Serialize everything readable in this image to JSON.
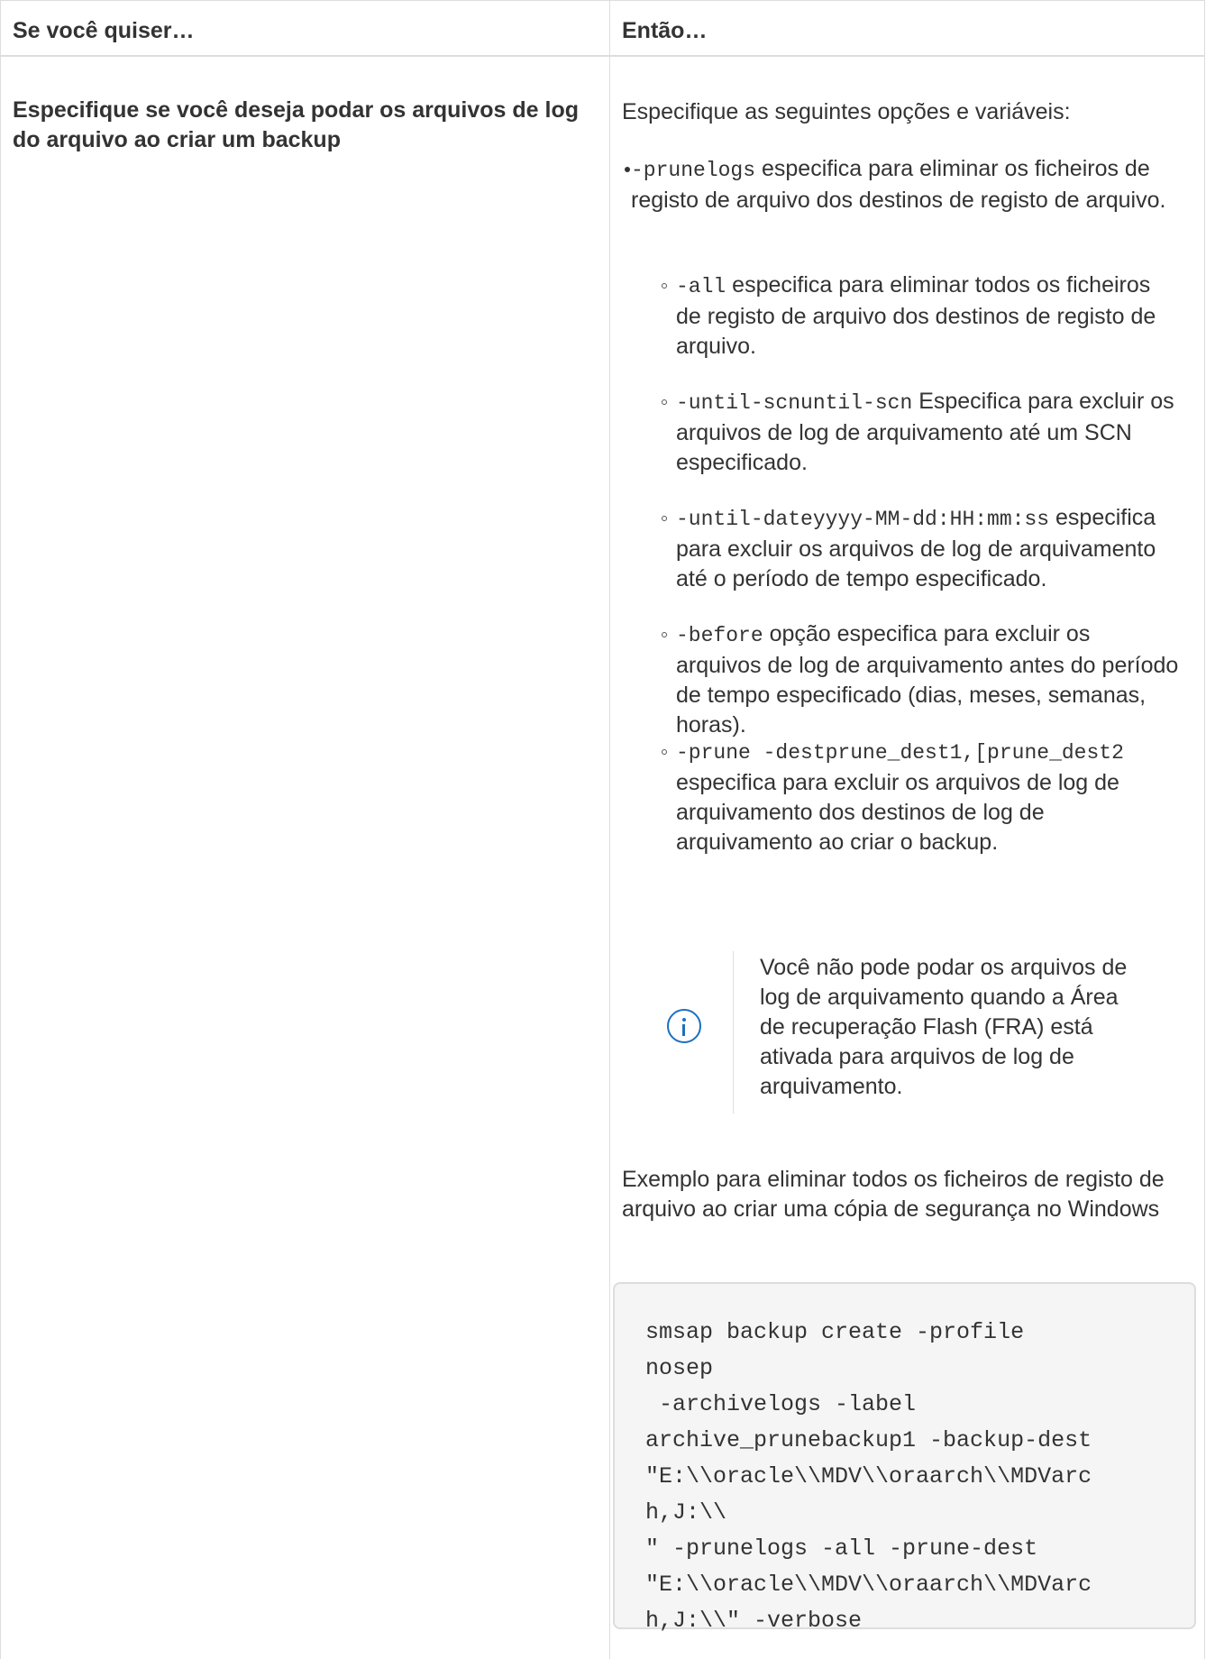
{
  "table": {
    "headers": [
      "Se você quiser…",
      "Então…"
    ],
    "row": {
      "left": "Especifique se você deseja podar os arquivos de log do arquivo ao criar um backup",
      "intro": "Especifique as seguintes opções e variáveis:",
      "bullet": {
        "code": "-prunelogs",
        "text": " especifica para eliminar os ficheiros de registo de arquivo dos destinos de registo de arquivo."
      },
      "subitems": [
        {
          "code": "-all",
          "text": " especifica para eliminar todos os ficheiros de registo de arquivo dos destinos de registo de arquivo."
        },
        {
          "code": "-until-scnuntil-scn",
          "text": " Especifica para excluir os arquivos de log de arquivamento até um SCN especificado."
        },
        {
          "code": "-until-dateyyyy-MM-dd:HH:mm:ss",
          "text": " especifica para excluir os arquivos de log de arquivamento até o período de tempo especificado."
        },
        {
          "code": "-before",
          "text": " opção especifica para excluir os arquivos de log de arquivamento antes do período de tempo especificado (dias, meses, semanas, horas)."
        },
        {
          "code": "-prune -destprune_dest1,[prune_dest2",
          "text": " especifica para excluir os arquivos de log de arquivamento dos destinos de log de arquivamento ao criar o backup."
        }
      ],
      "note": {
        "icon": "info-icon",
        "text": "Você não pode podar os arquivos de log de arquivamento quando a Área de recuperação Flash (FRA) está ativada para arquivos de log de arquivamento."
      },
      "example": "Exemplo para eliminar todos os ficheiros de registo de arquivo ao criar uma cópia de segurança no Windows",
      "code": "smsap backup create -profile\nnosep\n -archivelogs -label\narchive_prunebackup1 -backup-dest\n\"E:\\\\oracle\\\\MDV\\\\oraarch\\\\MDVarc\nh,J:\\\\\n\" -prunelogs -all -prune-dest\n\"E:\\\\oracle\\\\MDV\\\\oraarch\\\\MDVarc\nh,J:\\\\\" -verbose"
    }
  },
  "colors": {
    "border": "#dddddd",
    "text": "#333333",
    "info_icon": "#1e6fbf",
    "code_bg": "#f5f5f5"
  }
}
